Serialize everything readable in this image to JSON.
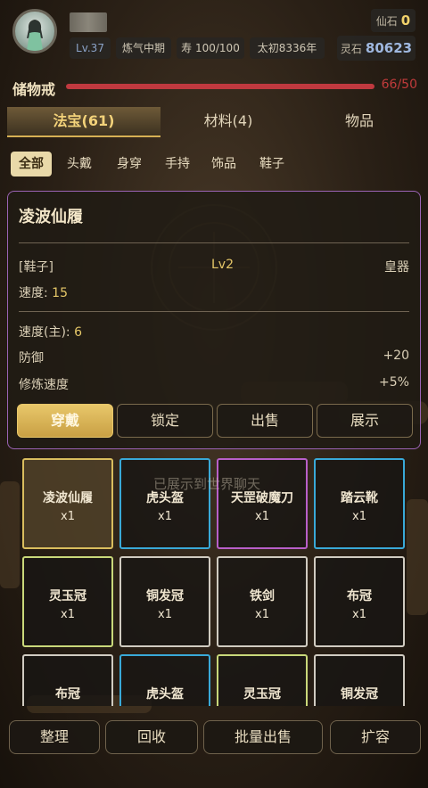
{
  "player": {
    "level": "Lv.37",
    "realm": "炼气中期",
    "lifespan": "寿 100/100",
    "era": "太初8336年"
  },
  "currency": {
    "xianshi_label": "仙石",
    "xianshi_value": "0",
    "lingshi_label": "灵石",
    "lingshi_value": "80623"
  },
  "storage": {
    "title": "储物戒",
    "capacity": "66/50",
    "fill_fraction": 1.0
  },
  "tabs": [
    {
      "label": "法宝(61)",
      "active": true
    },
    {
      "label": "材料(4)",
      "active": false
    },
    {
      "label": "物品",
      "active": false
    }
  ],
  "subtabs": [
    {
      "label": "全部",
      "active": true
    },
    {
      "label": "头戴",
      "active": false
    },
    {
      "label": "身穿",
      "active": false
    },
    {
      "label": "手持",
      "active": false
    },
    {
      "label": "饰品",
      "active": false
    },
    {
      "label": "鞋子",
      "active": false
    }
  ],
  "detail": {
    "name": "凌波仙履",
    "type": "[鞋子]",
    "level": "Lv2",
    "grade": "皇器",
    "speed_label": "速度:",
    "speed_value": "15",
    "main_label": "速度(主):",
    "main_value": "6",
    "stat1_label": "防御",
    "stat1_value": "+20",
    "stat2_label": "修炼速度",
    "stat2_value": "+5%",
    "buttons": {
      "equip": "穿戴",
      "lock": "锁定",
      "sell": "出售",
      "show": "展示"
    }
  },
  "toast": "已展示到世界聊天",
  "items": [
    {
      "name": "凌波仙履",
      "count": "x1",
      "border": "#d9bd5e",
      "selected": true
    },
    {
      "name": "虎头盔",
      "count": "x1",
      "border": "#39a9d8"
    },
    {
      "name": "天罡破魔刀",
      "count": "x1",
      "border": "#b85fc9"
    },
    {
      "name": "踏云靴",
      "count": "x1",
      "border": "#39a9d8"
    },
    {
      "name": "灵玉冠",
      "count": "x1",
      "border": "#c9d87a"
    },
    {
      "name": "铜发冠",
      "count": "x1",
      "border": "#d0cbc1"
    },
    {
      "name": "铁剑",
      "count": "x1",
      "border": "#d0cbc1"
    },
    {
      "name": "布冠",
      "count": "x1",
      "border": "#d0cbc1"
    },
    {
      "name": "布冠",
      "count": "",
      "border": "#d0cbc1"
    },
    {
      "name": "虎头盔",
      "count": "",
      "border": "#39a9d8"
    },
    {
      "name": "灵玉冠",
      "count": "",
      "border": "#c9d87a"
    },
    {
      "name": "铜发冠",
      "count": "",
      "border": "#d0cbc1"
    }
  ],
  "bottom_buttons": {
    "sort": "整理",
    "recycle": "回收",
    "batch_sell": "批量出售",
    "expand": "扩容"
  }
}
